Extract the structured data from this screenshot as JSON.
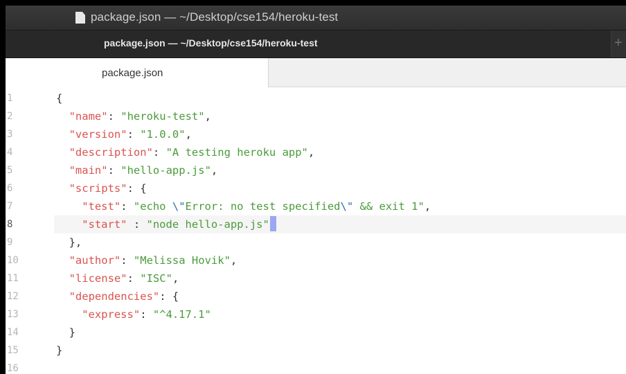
{
  "window": {
    "title": "package.json — ~/Desktop/cse154/heroku-test"
  },
  "tabbar": {
    "active_tab_label": "package.json — ~/Desktop/cse154/heroku-test",
    "new_tab_symbol": "+"
  },
  "editor_tabs": {
    "active_file": "package.json"
  },
  "editor": {
    "active_line": 8,
    "lines": [
      {
        "num": "1",
        "tokens": [
          [
            "punc",
            "{"
          ]
        ],
        "indent": 0
      },
      {
        "num": "2",
        "tokens": [
          [
            "key",
            "\"name\""
          ],
          [
            "punc",
            ": "
          ],
          [
            "str",
            "\"heroku-test\""
          ],
          [
            "punc",
            ","
          ]
        ],
        "indent": 1
      },
      {
        "num": "3",
        "tokens": [
          [
            "key",
            "\"version\""
          ],
          [
            "punc",
            ": "
          ],
          [
            "str",
            "\"1.0.0\""
          ],
          [
            "punc",
            ","
          ]
        ],
        "indent": 1
      },
      {
        "num": "4",
        "tokens": [
          [
            "key",
            "\"description\""
          ],
          [
            "punc",
            ": "
          ],
          [
            "str",
            "\"A testing heroku app\""
          ],
          [
            "punc",
            ","
          ]
        ],
        "indent": 1
      },
      {
        "num": "5",
        "tokens": [
          [
            "key",
            "\"main\""
          ],
          [
            "punc",
            ": "
          ],
          [
            "str",
            "\"hello-app.js\""
          ],
          [
            "punc",
            ","
          ]
        ],
        "indent": 1
      },
      {
        "num": "6",
        "tokens": [
          [
            "key",
            "\"scripts\""
          ],
          [
            "punc",
            ": {"
          ]
        ],
        "indent": 1
      },
      {
        "num": "7",
        "tokens": [
          [
            "key",
            "\"test\""
          ],
          [
            "punc",
            ": "
          ],
          [
            "str",
            "\"echo "
          ],
          [
            "esc",
            "\\\""
          ],
          [
            "str",
            "Error: no test specified"
          ],
          [
            "esc",
            "\\\""
          ],
          [
            "str",
            " && exit 1\""
          ],
          [
            "punc",
            ","
          ]
        ],
        "indent": 2
      },
      {
        "num": "8",
        "tokens": [
          [
            "key",
            "\"start\""
          ],
          [
            "punc",
            " : "
          ],
          [
            "str",
            "\"node hello-app.js\""
          ]
        ],
        "indent": 2,
        "cursor": true
      },
      {
        "num": "9",
        "tokens": [
          [
            "punc",
            "},"
          ]
        ],
        "indent": 1
      },
      {
        "num": "10",
        "tokens": [
          [
            "key",
            "\"author\""
          ],
          [
            "punc",
            ": "
          ],
          [
            "str",
            "\"Melissa Hovik\""
          ],
          [
            "punc",
            ","
          ]
        ],
        "indent": 1
      },
      {
        "num": "11",
        "tokens": [
          [
            "key",
            "\"license\""
          ],
          [
            "punc",
            ": "
          ],
          [
            "str",
            "\"ISC\""
          ],
          [
            "punc",
            ","
          ]
        ],
        "indent": 1
      },
      {
        "num": "12",
        "tokens": [
          [
            "key",
            "\"dependencies\""
          ],
          [
            "punc",
            ": {"
          ]
        ],
        "indent": 1
      },
      {
        "num": "13",
        "tokens": [
          [
            "key",
            "\"express\""
          ],
          [
            "punc",
            ": "
          ],
          [
            "str",
            "\"^4.17.1\""
          ]
        ],
        "indent": 2
      },
      {
        "num": "14",
        "tokens": [
          [
            "punc",
            "}"
          ]
        ],
        "indent": 1
      },
      {
        "num": "15",
        "tokens": [
          [
            "punc",
            "}"
          ]
        ],
        "indent": 0
      },
      {
        "num": "16",
        "tokens": [],
        "indent": 0
      }
    ]
  },
  "colors": {
    "key": "#d9534f",
    "string": "#4a9b3a",
    "escape": "#2f6fb8",
    "cursor": "#9ba7f0"
  }
}
